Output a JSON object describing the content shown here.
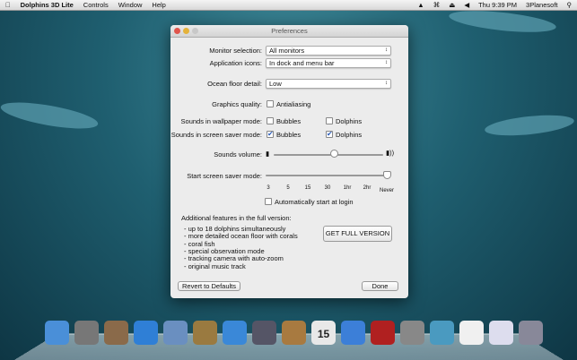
{
  "menubar": {
    "apple": "",
    "app": "Dolphins 3D Lite",
    "items": [
      "Controls",
      "Window",
      "Help"
    ],
    "clock": "Thu 9:39 PM",
    "user": "3Planesoft"
  },
  "window": {
    "title": "Preferences",
    "monitor": {
      "label": "Monitor selection:",
      "value": "All monitors"
    },
    "app_icons": {
      "label": "Application icons:",
      "value": "In dock and menu bar"
    },
    "ocean": {
      "label": "Ocean floor detail:",
      "value": "Low"
    },
    "graphics": {
      "label": "Graphics quality:",
      "antialiasing": "Antialiasing",
      "antialiasing_checked": false
    },
    "wallpaper": {
      "label": "Sounds in wallpaper mode:",
      "bubbles": "Bubbles",
      "dolphins": "Dolphins",
      "bubbles_checked": false,
      "dolphins_checked": false
    },
    "screensaver": {
      "label": "Sounds in screen saver mode:",
      "bubbles": "Bubbles",
      "dolphins": "Dolphins",
      "bubbles_checked": true,
      "dolphins_checked": true
    },
    "volume": {
      "label": "Sounds volume:",
      "value_percent": 55
    },
    "saver_mode": {
      "label": "Start screen saver mode:",
      "ticks": [
        "3",
        "5",
        "15",
        "30",
        "1hr",
        "2hr",
        "Never"
      ],
      "selected": "Never"
    },
    "autostart": {
      "label": "Automatically start at login",
      "checked": false
    },
    "features": {
      "heading": "Additional features in the full version:",
      "items": [
        "- up to 18 dolphins simultaneously",
        "- more detailed ocean floor with corals",
        "- coral fish",
        "- special observation mode",
        "- tracking camera with auto-zoom",
        "- original music track"
      ]
    },
    "get_full": "GET FULL VERSION",
    "revert": "Revert to Defaults",
    "done": "Done"
  },
  "dock": {
    "apps": [
      "finder",
      "launchpad",
      "mission-control",
      "app-store",
      "mail",
      "photos",
      "safari",
      "facetime",
      "contacts",
      "calendar",
      "itunes",
      "photo-booth",
      "system-preferences",
      "dolphins-3d-lite",
      "documents",
      "downloads",
      "trash"
    ],
    "calendar_day": "15"
  }
}
